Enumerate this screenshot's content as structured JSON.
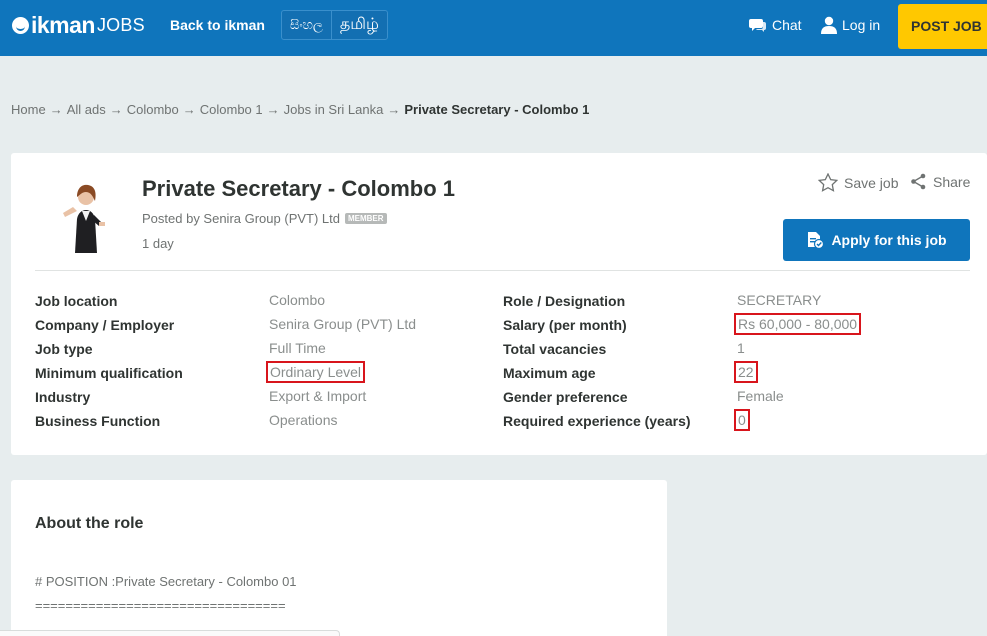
{
  "header": {
    "brand": "ikman",
    "brand_suffix": "JOBS",
    "back_link": "Back to ikman",
    "languages": [
      "සිංහල",
      "தமிழ்"
    ],
    "chat": "Chat",
    "login": "Log in",
    "post_job": "POST JOB",
    "colors": {
      "header_bg": "#0f75bc",
      "post_job_bg": "#ffc800"
    }
  },
  "breadcrumb": {
    "items": [
      "Home",
      "All ads",
      "Colombo",
      "Colombo 1",
      "Jobs in Sri Lanka"
    ],
    "separator": "→",
    "current": "Private Secretary - Colombo 1"
  },
  "job": {
    "title": "Private Secretary - Colombo 1",
    "posted_by": "Posted by Senira Group (PVT) Ltd",
    "member_badge": "MEMBER",
    "posted_time": "1 day",
    "save_job": "Save job",
    "share": "Share",
    "apply": "Apply for this job",
    "details_left": [
      {
        "label": "Job location",
        "value": "Colombo"
      },
      {
        "label": "Company / Employer",
        "value": "Senira Group (PVT) Ltd"
      },
      {
        "label": "Job type",
        "value": "Full Time"
      },
      {
        "label": "Minimum qualification",
        "value": "Ordinary Level"
      },
      {
        "label": "Industry",
        "value": "Export & Import"
      },
      {
        "label": "Business Function",
        "value": "Operations"
      }
    ],
    "details_right": [
      {
        "label": "Role / Designation",
        "value": "SECRETARY"
      },
      {
        "label": "Salary (per month)",
        "value": "Rs 60,000 - 80,000"
      },
      {
        "label": "Total vacancies",
        "value": "1"
      },
      {
        "label": "Maximum age",
        "value": "22"
      },
      {
        "label": "Gender preference",
        "value": "Female"
      },
      {
        "label": "Required experience (years)",
        "value": "0"
      }
    ],
    "highlight_color": "#d8151c"
  },
  "about": {
    "heading": "About the role",
    "lines": [
      "# POSITION :Private Secretary - Colombo 01",
      "================================="
    ]
  }
}
